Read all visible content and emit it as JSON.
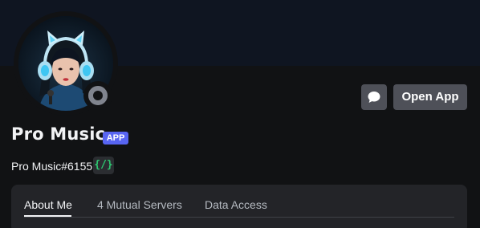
{
  "profile": {
    "display_name": "Pro Music",
    "badge": "APP",
    "username": "Pro Music#6155",
    "code_badge": "{/}",
    "status": "offline"
  },
  "actions": {
    "message_icon": "speech-bubble-icon",
    "open_app_label": "Open App"
  },
  "tabs": [
    {
      "label": "About Me",
      "active": true
    },
    {
      "label": "4 Mutual Servers",
      "active": false
    },
    {
      "label": "Data Access",
      "active": false
    }
  ],
  "colors": {
    "background": "#111214",
    "banner": "#0f1521",
    "button": "#4e5058",
    "app_badge": "#5865f2",
    "code_badge_text": "#2dc770",
    "card": "#232428",
    "status_offline": "#80848e"
  }
}
